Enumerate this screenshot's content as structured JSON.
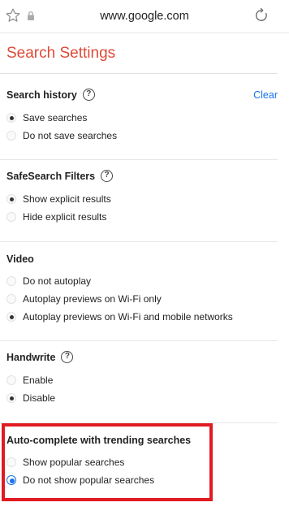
{
  "browser": {
    "url": "www.google.com"
  },
  "page": {
    "title": "Search Settings"
  },
  "sections": {
    "history": {
      "heading": "Search history",
      "help": "?",
      "action": "Clear",
      "options": [
        "Save searches",
        "Do not save searches"
      ],
      "selected": 0
    },
    "safesearch": {
      "heading": "SafeSearch Filters",
      "help": "?",
      "options": [
        "Show explicit results",
        "Hide explicit results"
      ],
      "selected": 0
    },
    "video": {
      "heading": "Video",
      "options": [
        "Do not autoplay",
        "Autoplay previews on Wi-Fi only",
        "Autoplay previews on Wi-Fi and mobile networks"
      ],
      "selected": 2
    },
    "handwrite": {
      "heading": "Handwrite",
      "help": "?",
      "options": [
        "Enable",
        "Disable"
      ],
      "selected": 1
    },
    "autocomplete": {
      "heading": "Auto-complete with trending searches",
      "options": [
        "Show popular searches",
        "Do not show popular searches"
      ],
      "selected": 1
    }
  },
  "colors": {
    "title": "#dd4b39",
    "link": "#1a73e8",
    "highlight": "#e11b22"
  }
}
